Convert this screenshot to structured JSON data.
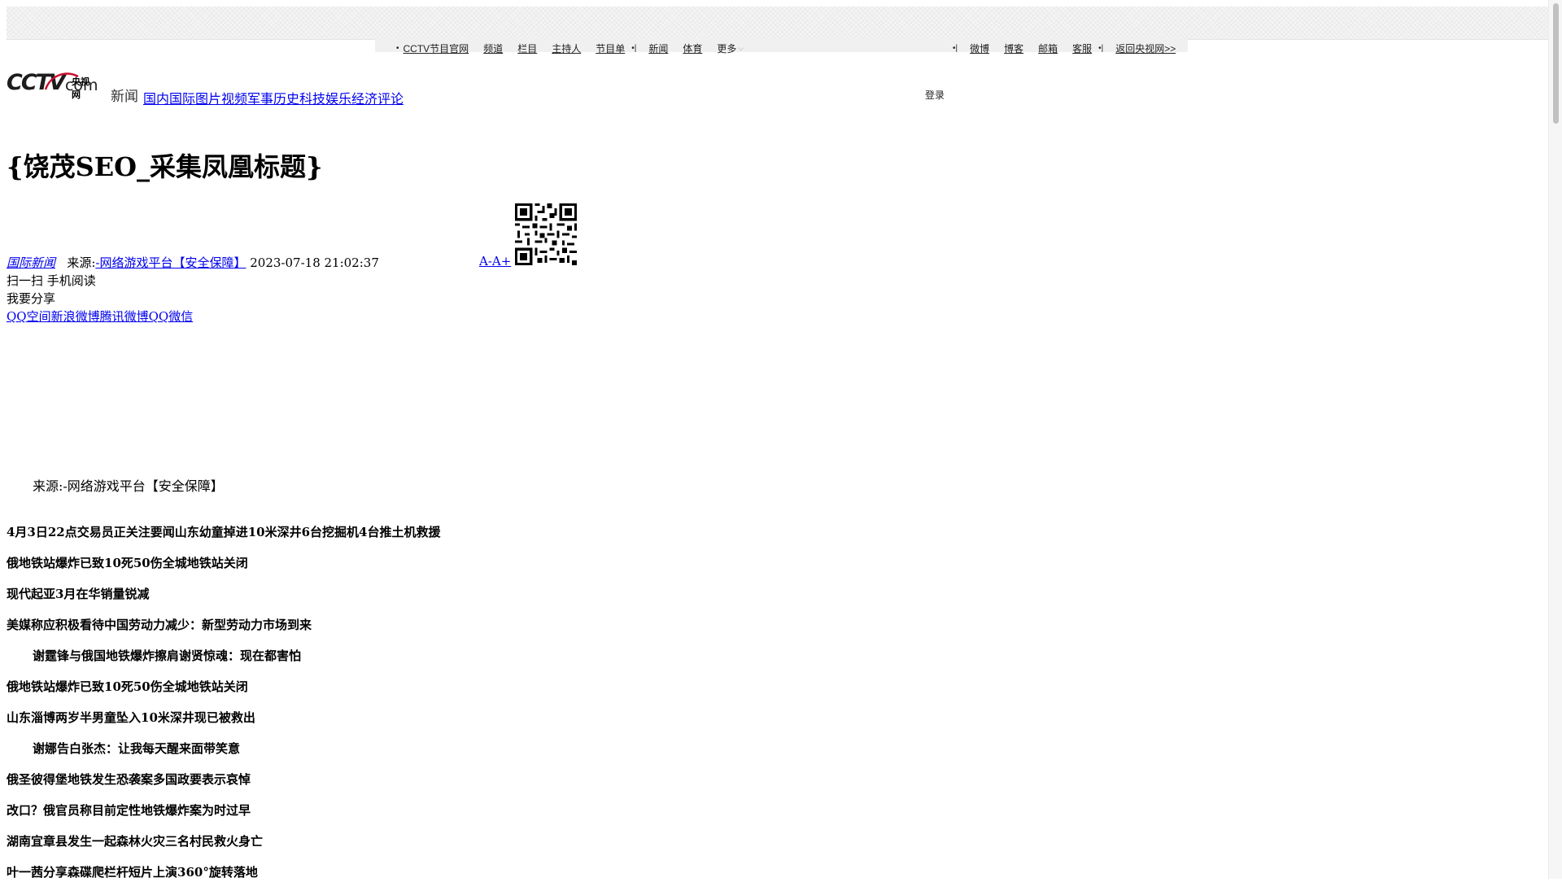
{
  "topnav": {
    "left_items": [
      "CCTV节目官网",
      "频道",
      "栏目",
      "主持人",
      "节目单"
    ],
    "mid_items": [
      "新闻",
      "体育"
    ],
    "more_label": "更多",
    "right_items": [
      "微博",
      "博客",
      "邮箱",
      "客服"
    ],
    "return_label": "返回央视网>>"
  },
  "header": {
    "logo_text": "CCTV",
    "logo_com": "com",
    "logo_cn": "央视网",
    "section_label": "新闻",
    "channels": "国内国际图片视频军事历史科技娱乐经济评论",
    "login_label": "登录"
  },
  "article": {
    "title": "{饶茂SEO_采集凤凰标题}",
    "category": "国际新闻",
    "source_prefix": "来源:",
    "source_link": "-网络游戏平台【安全保障】",
    "datetime": "2023-07-18 21:02:37",
    "font_minus": "A-",
    "font_plus": "A+",
    "scan_text": "扫一扫 手机阅读",
    "share_label": "我要分享",
    "share_links": "QQ空间新浪微博腾讯微博QQ微信",
    "source_line": "来源:-网络游戏平台【安全保障】"
  },
  "headlines": [
    {
      "text": "4月3日22点交易员正关注要闻山东幼童掉进10米深井6台挖掘机4台推土机救援",
      "indent": false
    },
    {
      "text": "俄地铁站爆炸已致10死50伤全城地铁站关闭",
      "indent": false
    },
    {
      "text": "现代起亚3月在华销量锐减",
      "indent": false
    },
    {
      "text": "美媒称应积极看待中国劳动力减少：新型劳动力市场到来",
      "indent": false
    },
    {
      "text": "谢霆锋与俄国地铁爆炸擦肩谢贤惊魂：现在都害怕",
      "indent": true
    },
    {
      "text": "俄地铁站爆炸已致10死50伤全城地铁站关闭",
      "indent": false
    },
    {
      "text": "山东淄博两岁半男童坠入10米深井现已被救出",
      "indent": false
    },
    {
      "text": "谢娜告白张杰：让我每天醒来面带笑意",
      "indent": true
    },
    {
      "text": "俄圣彼得堡地铁发生恐袭案多国政要表示哀悼",
      "indent": false
    },
    {
      "text": "改口？俄官员称目前定性地铁爆炸案为时过早",
      "indent": false
    },
    {
      "text": "湖南宜章县发生一起森林火灾三名村民救火身亡",
      "indent": false
    },
    {
      "text": "叶一茜分享森碟爬栏杆短片上演360°旋转落地",
      "indent": false
    }
  ]
}
